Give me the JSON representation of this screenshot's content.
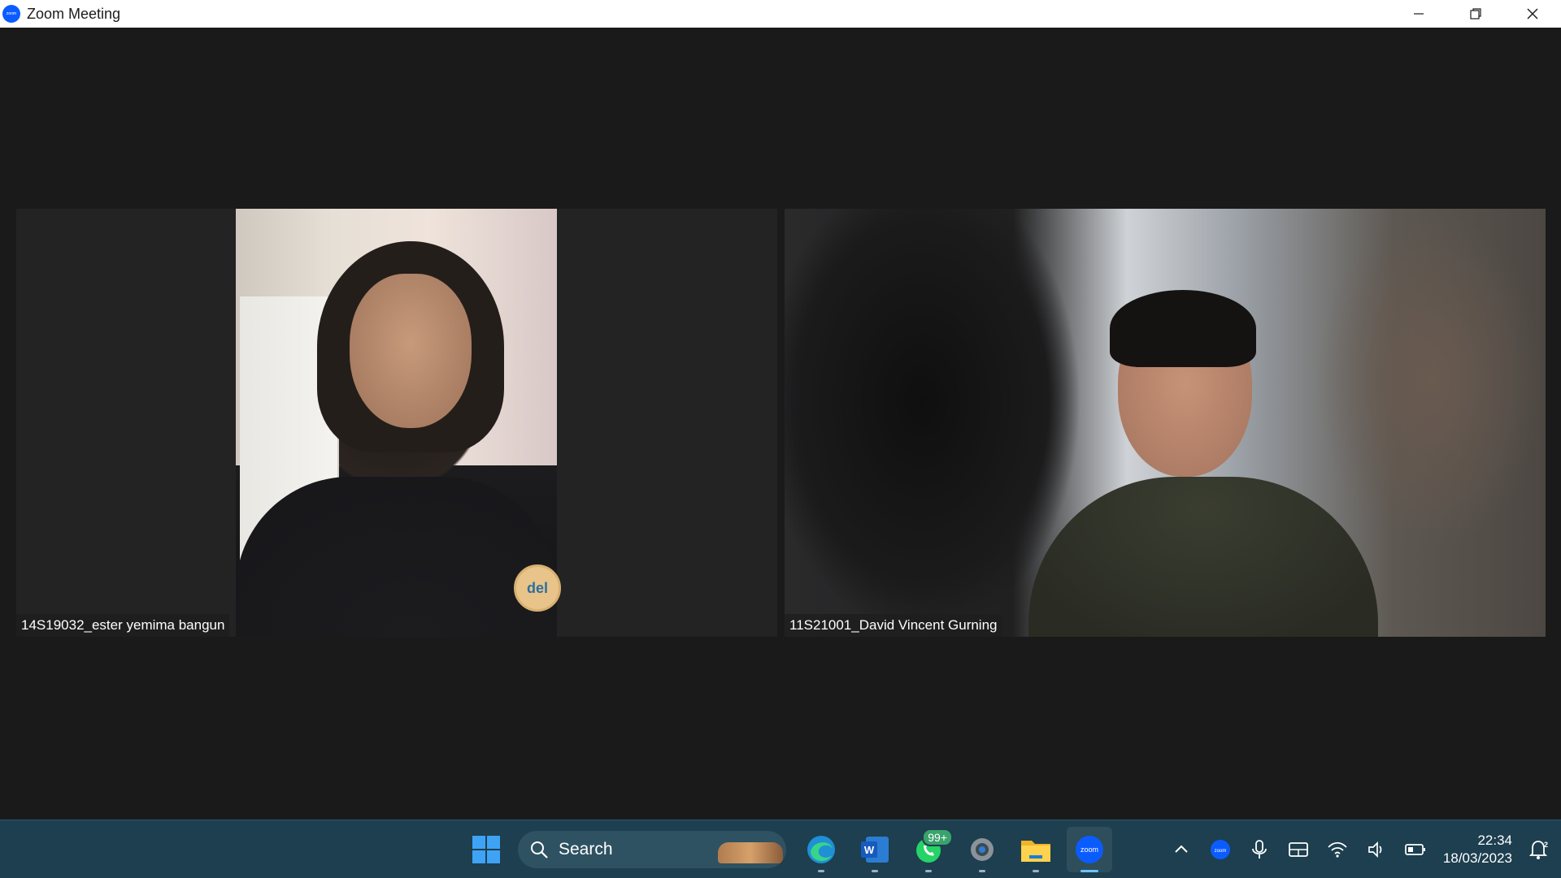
{
  "window": {
    "title": "Zoom Meeting",
    "app_icon_text": "zoom",
    "controls": [
      "minimize",
      "restore",
      "close"
    ]
  },
  "participants": [
    {
      "name": "14S19032_ester yemima bangun",
      "badge_text": "del"
    },
    {
      "name": "11S21001_David Vincent Gurning"
    }
  ],
  "taskbar": {
    "search_label": "Search",
    "apps": [
      {
        "name": "start",
        "icon": "windows-icon"
      },
      {
        "name": "edge",
        "icon": "edge-icon"
      },
      {
        "name": "word",
        "icon": "word-icon",
        "label": "W"
      },
      {
        "name": "whatsapp",
        "icon": "whatsapp-icon",
        "badge": "99+"
      },
      {
        "name": "settings",
        "icon": "gear-icon"
      },
      {
        "name": "file-explorer",
        "icon": "folder-icon"
      },
      {
        "name": "zoom",
        "icon": "zoom-icon",
        "label": "zoom"
      }
    ],
    "tray": {
      "zoom_label": "zoom",
      "time": "22:34",
      "date": "18/03/2023",
      "notification_count": "2"
    }
  },
  "colors": {
    "stage_bg": "#1a1a1a",
    "tile_bg": "#232323",
    "taskbar_bg": "#1d3f4f",
    "zoom_blue": "#0b5cff"
  }
}
